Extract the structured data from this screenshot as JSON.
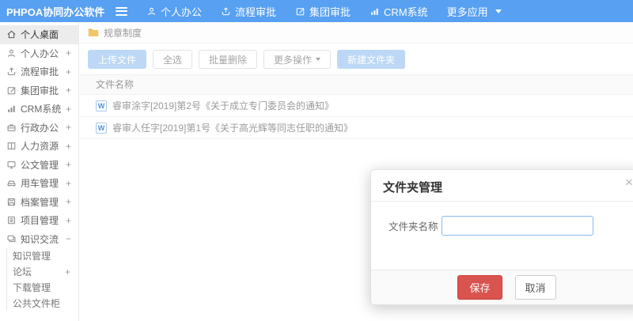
{
  "topbar": {
    "logo": "PHPOA协同办公软件",
    "nav": [
      {
        "label": "个人办公",
        "icon": "user-icon"
      },
      {
        "label": "流程审批",
        "icon": "upload-icon"
      },
      {
        "label": "集团审批",
        "icon": "edit-icon"
      },
      {
        "label": "CRM系统",
        "icon": "chart-icon"
      },
      {
        "label": "更多应用",
        "icon": "caret-down-icon"
      }
    ]
  },
  "sidebar": {
    "items": [
      {
        "label": "个人桌面",
        "icon": "home-icon",
        "expand": "",
        "active": true
      },
      {
        "label": "个人办公",
        "icon": "user-icon",
        "expand": "+"
      },
      {
        "label": "流程审批",
        "icon": "upload-icon",
        "expand": "+"
      },
      {
        "label": "集团审批",
        "icon": "edit-icon",
        "expand": "+"
      },
      {
        "label": "CRM系统",
        "icon": "chart-icon",
        "expand": "+"
      },
      {
        "label": "行政办公",
        "icon": "briefcase-icon",
        "expand": "+"
      },
      {
        "label": "人力资源",
        "icon": "book-icon",
        "expand": "+"
      },
      {
        "label": "公文管理",
        "icon": "monitor-icon",
        "expand": "+"
      },
      {
        "label": "用车管理",
        "icon": "car-icon",
        "expand": "+"
      },
      {
        "label": "档案管理",
        "icon": "disk-icon",
        "expand": "+"
      },
      {
        "label": "项目管理",
        "icon": "clipboard-icon",
        "expand": "+"
      },
      {
        "label": "知识交流",
        "icon": "chat-icon",
        "expand": "−"
      }
    ],
    "subitems": [
      {
        "label": "知识管理",
        "expand": ""
      },
      {
        "label": "论坛",
        "expand": "+"
      },
      {
        "label": "下载管理",
        "expand": ""
      },
      {
        "label": "公共文件柜",
        "expand": ""
      }
    ]
  },
  "breadcrumb": {
    "label": "规章制度",
    "icon": "folder-icon"
  },
  "toolbar": {
    "upload": "上传文件",
    "select_all": "全选",
    "batch_delete": "批量删除",
    "more_actions": "更多操作",
    "new_folder": "新建文件夹"
  },
  "files": {
    "header": "文件名称",
    "doc_letter": "W",
    "rows": [
      {
        "name": "睿审涂字[2019]第2号《关于成立专门委员会的通知》"
      },
      {
        "name": "睿审人任字[2019]第1号《关于高光辉等同志任职的通知》"
      }
    ]
  },
  "modal": {
    "title": "文件夹管理",
    "close": "×",
    "field_label": "文件夹名称",
    "field_value": "",
    "save": "保存",
    "cancel": "取消"
  },
  "colors": {
    "topbar_blue": "#57a0f2",
    "primary_light_blue": "#bcd8f6",
    "save_red": "#d9534f",
    "folder_yellow": "#f3c569",
    "active_item_bg": "#ececec"
  }
}
